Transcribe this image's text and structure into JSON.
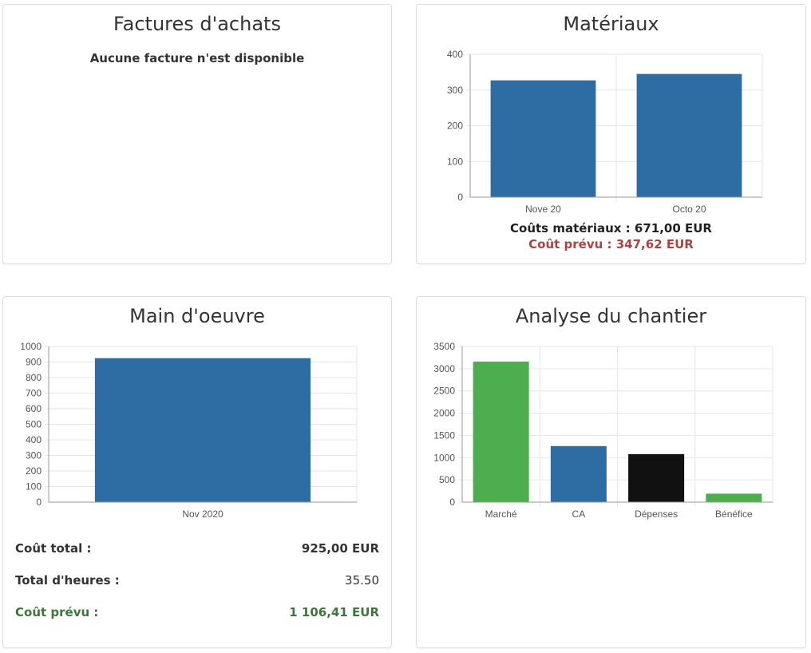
{
  "factures": {
    "title": "Factures d'achats",
    "empty_message": "Aucune facture n'est disponible"
  },
  "materiaux": {
    "title": "Matériaux",
    "cost_label": "Coûts matériaux : 671,00 EUR",
    "planned_label": "Coût prévu : 347,62 EUR",
    "colors": {
      "bar": "#2e6da4",
      "planned": "#a94442"
    }
  },
  "main_oeuvre": {
    "title": "Main d'oeuvre",
    "rows": [
      {
        "label": "Coût total :",
        "value": "925,00 EUR"
      },
      {
        "label": "Total d'heures :",
        "value": "35.50"
      },
      {
        "label": "Coût prévu :",
        "value": "1 106,41 EUR"
      }
    ],
    "colors": {
      "bar": "#2e6da4",
      "planned": "#3c763d"
    }
  },
  "analyse": {
    "title": "Analyse du chantier"
  },
  "chart_data": [
    {
      "type": "bar",
      "categories": [
        "Nove 20",
        "Octo 20"
      ],
      "values": [
        327,
        345
      ],
      "ylim": [
        0,
        400
      ],
      "yticks": [
        0,
        100,
        200,
        300,
        400
      ],
      "colors": [
        "#2e6da4",
        "#2e6da4"
      ],
      "grid": true
    },
    {
      "type": "bar",
      "categories": [
        "Nov 2020"
      ],
      "values": [
        925
      ],
      "ylim": [
        0,
        1000
      ],
      "yticks": [
        0,
        100,
        200,
        300,
        400,
        500,
        600,
        700,
        800,
        900,
        1000
      ],
      "colors": [
        "#2e6da4"
      ],
      "grid": true
    },
    {
      "type": "bar",
      "categories": [
        "Marché",
        "CA",
        "Dépenses",
        "Bénéfice"
      ],
      "values": [
        3160,
        1260,
        1080,
        190
      ],
      "ylim": [
        0,
        3500
      ],
      "yticks": [
        0,
        500,
        1000,
        1500,
        2000,
        2500,
        3000,
        3500
      ],
      "colors": [
        "#4cae4c",
        "#2e6da4",
        "#111111",
        "#4cae4c"
      ],
      "grid": true
    }
  ]
}
